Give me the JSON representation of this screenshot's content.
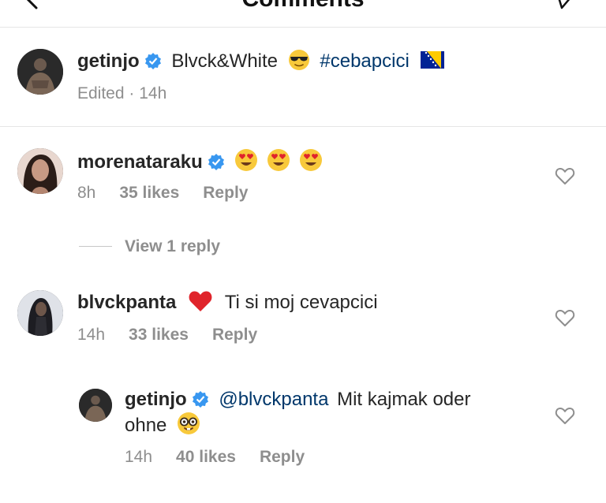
{
  "header": {
    "title": "Comments"
  },
  "caption": {
    "username": "getinjo",
    "text_part1": "Blvck&White",
    "hashtag": "#cebapcici",
    "meta": "Edited · 14h"
  },
  "comments": [
    {
      "username": "morenataraku",
      "time": "8h",
      "likes": "35 likes",
      "reply": "Reply",
      "view_replies": "View 1 reply"
    },
    {
      "username": "blvckpanta",
      "text": "Ti si moj cevapcici",
      "time": "14h",
      "likes": "33 likes",
      "reply": "Reply"
    }
  ],
  "reply": {
    "username": "getinjo",
    "mention": "@blvckpanta",
    "text_line1": "Mit kajmak oder",
    "text_line2": "ohne",
    "time": "14h",
    "likes": "40 likes",
    "reply": "Reply"
  },
  "colors": {
    "verified": "#3897f0",
    "link": "#00376b",
    "meta": "#8e8e8e",
    "heart_red": "#e0242b"
  },
  "icons": [
    "back-arrow-icon",
    "send-icon",
    "verified-badge-icon",
    "heart-outline-icon",
    "sunglasses-emoji",
    "bosnia-flag-emoji",
    "heart-eyes-emoji",
    "red-heart-emoji",
    "nerd-face-emoji"
  ]
}
